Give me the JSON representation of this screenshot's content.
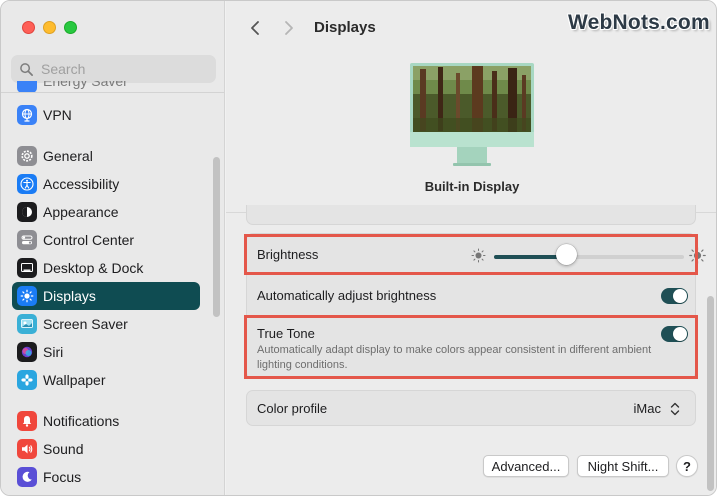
{
  "search": {
    "placeholder": "Search"
  },
  "sidebar": {
    "partial_item": "Energy Saver",
    "items": [
      {
        "label": "VPN",
        "icon": "globe-icon",
        "color": "#3a82f7"
      },
      {
        "label": "General",
        "icon": "gear-icon",
        "color": "#8e8e93"
      },
      {
        "label": "Accessibility",
        "icon": "accessibility-icon",
        "color": "#1a7cf5"
      },
      {
        "label": "Appearance",
        "icon": "appearance-icon",
        "color": "#1c1c1e"
      },
      {
        "label": "Control Center",
        "icon": "control-center-icon",
        "color": "#8e8e93"
      },
      {
        "label": "Desktop & Dock",
        "icon": "dock-icon",
        "color": "#1c1c1e"
      },
      {
        "label": "Displays",
        "icon": "sun-icon",
        "color": "#1a7cf5",
        "active": true
      },
      {
        "label": "Screen Saver",
        "icon": "screen-saver-icon",
        "color": "#3ab0d6"
      },
      {
        "label": "Siri",
        "icon": "siri-icon",
        "color": "#6a3fd0"
      },
      {
        "label": "Wallpaper",
        "icon": "flower-icon",
        "color": "#2aa6e0"
      },
      {
        "label": "Notifications",
        "icon": "bell-icon",
        "color": "#f0473c"
      },
      {
        "label": "Sound",
        "icon": "speaker-icon",
        "color": "#f0473c"
      },
      {
        "label": "Focus",
        "icon": "moon-icon",
        "color": "#5a4fd6"
      }
    ]
  },
  "header": {
    "title": "Displays",
    "back_icon": "chevron-left-icon",
    "forward_icon": "chevron-right-icon"
  },
  "watermark": "WebNots.com",
  "display": {
    "name": "Built-in Display"
  },
  "settings": {
    "brightness": {
      "label": "Brightness",
      "level": 0.38
    },
    "auto_brightness": {
      "label": "Automatically adjust brightness",
      "on": true
    },
    "true_tone": {
      "label": "True Tone",
      "description": "Automatically adapt display to make colors appear consistent in different ambient lighting conditions.",
      "on": true
    },
    "color_profile": {
      "label": "Color profile",
      "value": "iMac"
    }
  },
  "buttons": {
    "advanced": "Advanced...",
    "night_shift": "Night Shift...",
    "help": "?"
  },
  "colors": {
    "accent": "#1f4f55",
    "highlight": "#e4574a",
    "sidebar_active": "#0f4c52"
  }
}
